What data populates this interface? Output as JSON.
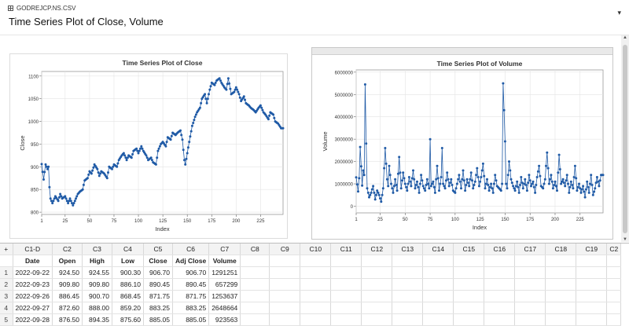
{
  "header": {
    "file_name": "GODREJCP.NS.CSV",
    "title": "Time Series Plot of Close, Volume"
  },
  "columns": [
    {
      "id": "+",
      "name": ""
    },
    {
      "id": "C1-D",
      "name": "Date"
    },
    {
      "id": "C2",
      "name": "Open"
    },
    {
      "id": "C3",
      "name": "High"
    },
    {
      "id": "C4",
      "name": "Low"
    },
    {
      "id": "C5",
      "name": "Close"
    },
    {
      "id": "C6",
      "name": "Adj Close"
    },
    {
      "id": "C7",
      "name": "Volume"
    },
    {
      "id": "C8",
      "name": ""
    },
    {
      "id": "C9",
      "name": ""
    },
    {
      "id": "C10",
      "name": ""
    },
    {
      "id": "C11",
      "name": ""
    },
    {
      "id": "C12",
      "name": ""
    },
    {
      "id": "C13",
      "name": ""
    },
    {
      "id": "C14",
      "name": ""
    },
    {
      "id": "C15",
      "name": ""
    },
    {
      "id": "C16",
      "name": ""
    },
    {
      "id": "C17",
      "name": ""
    },
    {
      "id": "C18",
      "name": ""
    },
    {
      "id": "C19",
      "name": ""
    },
    {
      "id": "C2",
      "name": ""
    }
  ],
  "rows": [
    {
      "n": "1",
      "date": "2022-09-22",
      "open": "924.50",
      "high": "924.55",
      "low": "900.30",
      "close": "906.70",
      "adj": "906.70",
      "vol": "1291251"
    },
    {
      "n": "2",
      "date": "2022-09-23",
      "open": "909.80",
      "high": "909.80",
      "low": "886.10",
      "close": "890.45",
      "adj": "890.45",
      "vol": "657299"
    },
    {
      "n": "3",
      "date": "2022-09-26",
      "open": "886.45",
      "high": "900.70",
      "low": "868.45",
      "close": "871.75",
      "adj": "871.75",
      "vol": "1253637"
    },
    {
      "n": "4",
      "date": "2022-09-27",
      "open": "872.60",
      "high": "888.00",
      "low": "859.20",
      "close": "883.25",
      "adj": "883.25",
      "vol": "2648664"
    },
    {
      "n": "5",
      "date": "2022-09-28",
      "open": "876.50",
      "high": "894.35",
      "low": "875.60",
      "close": "885.05",
      "adj": "885.05",
      "vol": "923563"
    }
  ],
  "chart_data": [
    {
      "type": "line",
      "title": "Time Series Plot of Close",
      "xlabel": "Index",
      "ylabel": "Close",
      "xlim": [
        1,
        248
      ],
      "ylim": [
        795,
        1110
      ],
      "xticks": [
        1,
        25,
        50,
        75,
        100,
        125,
        150,
        175,
        200,
        225
      ],
      "yticks": [
        800,
        850,
        900,
        950,
        1000,
        1050,
        1100
      ],
      "grid": true,
      "x_anchor": [
        1,
        3,
        5,
        7,
        8,
        9,
        10,
        12,
        15,
        18,
        20,
        22,
        25,
        28,
        30,
        33,
        35,
        38,
        40,
        43,
        45,
        48,
        50,
        52,
        55,
        58,
        60,
        62,
        65,
        68,
        70,
        73,
        75,
        78,
        80,
        83,
        85,
        88,
        90,
        93,
        95,
        98,
        100,
        103,
        105,
        108,
        110,
        113,
        115,
        118,
        120,
        123,
        125,
        128,
        130,
        133,
        135,
        138,
        140,
        143,
        145,
        147,
        148,
        150,
        152,
        155,
        158,
        160,
        163,
        165,
        168,
        170,
        173,
        175,
        178,
        180,
        183,
        185,
        188,
        190,
        192,
        195,
        198,
        200,
        203,
        205,
        208,
        210,
        213,
        215,
        218,
        220,
        223,
        225,
        228,
        230,
        233,
        235,
        238,
        240,
        243,
        246
      ],
      "y_anchor": [
        906,
        872,
        905,
        895,
        900,
        855,
        830,
        820,
        835,
        825,
        840,
        830,
        835,
        820,
        830,
        815,
        825,
        840,
        845,
        850,
        870,
        875,
        890,
        885,
        905,
        895,
        880,
        890,
        885,
        875,
        900,
        895,
        905,
        900,
        915,
        925,
        930,
        915,
        925,
        920,
        935,
        940,
        930,
        945,
        935,
        925,
        915,
        920,
        910,
        905,
        935,
        950,
        955,
        945,
        965,
        960,
        975,
        970,
        975,
        980,
        960,
        915,
        905,
        930,
        955,
        990,
        1010,
        1020,
        1030,
        1050,
        1060,
        1040,
        1070,
        1085,
        1080,
        1090,
        1095,
        1085,
        1075,
        1070,
        1095,
        1060,
        1065,
        1075,
        1060,
        1045,
        1055,
        1040,
        1035,
        1030,
        1025,
        1020,
        1030,
        1035,
        1020,
        1015,
        1005,
        1020,
        1015,
        1000,
        995,
        985
      ]
    },
    {
      "type": "line",
      "title": "Time Series Plot of Volume",
      "xlabel": "Index",
      "ylabel": "Volume",
      "xlim": [
        1,
        248
      ],
      "ylim": [
        -300000,
        6100000
      ],
      "xticks": [
        1,
        25,
        50,
        75,
        100,
        125,
        150,
        175,
        200,
        225
      ],
      "yticks": [
        0,
        1000000,
        2000000,
        3000000,
        4000000,
        5000000,
        6000000
      ],
      "grid": true,
      "x_anchor": [
        1,
        3,
        4,
        5,
        7,
        8,
        9,
        10,
        11,
        12,
        14,
        16,
        18,
        20,
        22,
        24,
        26,
        28,
        30,
        32,
        33,
        34,
        36,
        38,
        40,
        42,
        44,
        46,
        48,
        50,
        52,
        54,
        56,
        58,
        60,
        62,
        64,
        66,
        68,
        70,
        72,
        74,
        75,
        76,
        78,
        80,
        82,
        84,
        86,
        87,
        88,
        90,
        92,
        94,
        96,
        98,
        100,
        102,
        104,
        106,
        108,
        110,
        112,
        114,
        116,
        118,
        120,
        122,
        124,
        126,
        128,
        130,
        132,
        134,
        136,
        138,
        140,
        142,
        144,
        146,
        147,
        148,
        149,
        150,
        151,
        152,
        154,
        156,
        158,
        160,
        162,
        164,
        166,
        168,
        170,
        172,
        174,
        176,
        178,
        180,
        182,
        184,
        186,
        188,
        190,
        192,
        194,
        196,
        198,
        200,
        202,
        204,
        206,
        208,
        210,
        212,
        214,
        216,
        218,
        220,
        222,
        224,
        226,
        228,
        230,
        232,
        234,
        236,
        238,
        240,
        242,
        244,
        246
      ],
      "y_anchor": [
        1290000,
        657000,
        1250000,
        2650000,
        924000,
        1600000,
        1400000,
        5450000,
        2800000,
        800000,
        400000,
        600000,
        900000,
        300000,
        700000,
        500000,
        200000,
        800000,
        2600000,
        1200000,
        900000,
        1800000,
        1000000,
        600000,
        1200000,
        700000,
        2200000,
        800000,
        1500000,
        1000000,
        700000,
        1300000,
        900000,
        1600000,
        800000,
        1100000,
        600000,
        1400000,
        900000,
        700000,
        1200000,
        800000,
        3000000,
        900000,
        1100000,
        600000,
        1800000,
        700000,
        1300000,
        2600000,
        1000000,
        800000,
        1500000,
        900000,
        1200000,
        700000,
        600000,
        1000000,
        1400000,
        800000,
        1600000,
        700000,
        1200000,
        900000,
        1500000,
        800000,
        1100000,
        1700000,
        900000,
        1300000,
        1900000,
        800000,
        1200000,
        700000,
        1000000,
        600000,
        1400000,
        900000,
        800000,
        700000,
        1000000,
        5500000,
        4300000,
        2900000,
        1000000,
        800000,
        2000000,
        1200000,
        900000,
        700000,
        1100000,
        600000,
        1300000,
        800000,
        1200000,
        700000,
        1400000,
        900000,
        1100000,
        600000,
        1300000,
        1800000,
        900000,
        800000,
        1200000,
        2400000,
        1000000,
        1400000,
        800000,
        1100000,
        700000,
        2300000,
        1000000,
        1200000,
        900000,
        1400000,
        600000,
        1100000,
        800000,
        1800000,
        700000,
        1000000,
        600000,
        900000,
        400000,
        1100000,
        600000,
        1400000,
        500000,
        800000,
        1300000,
        900000,
        1400000
      ]
    }
  ]
}
